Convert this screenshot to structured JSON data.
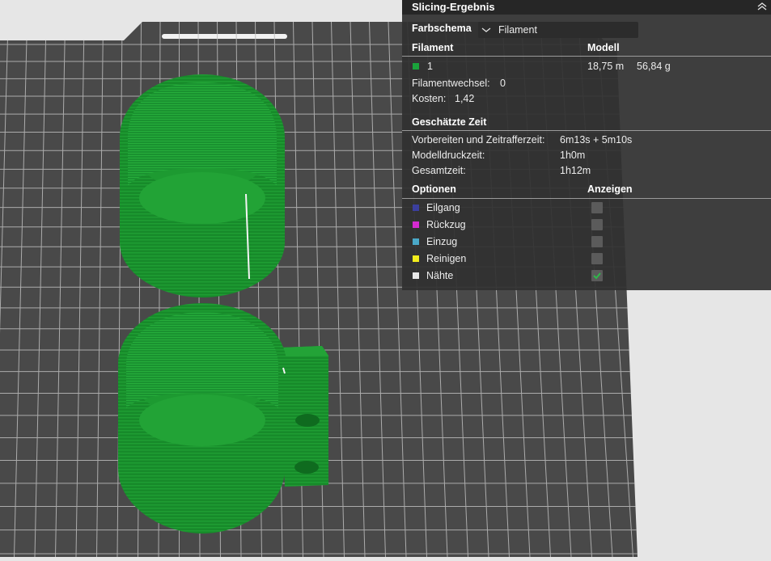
{
  "panel": {
    "title": "Slicing-Ergebnis",
    "color_scheme_label": "Farbschema",
    "color_scheme_value": "Filament",
    "col_filament": "Filament",
    "col_model": "Modell",
    "filament": {
      "id": "1",
      "color": "#1aa33b",
      "length": "18,75 m",
      "weight": "56,84 g"
    },
    "filament_changes_label": "Filamentwechsel:",
    "filament_changes_value": "0",
    "cost_label": "Kosten:",
    "cost_value": "1,42",
    "time_header": "Geschätzte Zeit",
    "prep_label": "Vorbereiten und Zeitrafferzeit:",
    "prep_value": "6m13s + 5m10s",
    "model_time_label": "Modelldruckzeit:",
    "model_time_value": "1h0m",
    "total_label": "Gesamtzeit:",
    "total_value": "1h12m",
    "options_header": "Optionen",
    "show_header": "Anzeigen",
    "options": [
      {
        "label": "Eilgang",
        "color": "#3b3f9e",
        "checked": false
      },
      {
        "label": "Rückzug",
        "color": "#d62ad1",
        "checked": false
      },
      {
        "label": "Einzug",
        "color": "#4aa8c8",
        "checked": false
      },
      {
        "label": "Reinigen",
        "color": "#f2ec1c",
        "checked": false
      },
      {
        "label": "Nähte",
        "color": "#e8e8e8",
        "checked": true
      }
    ],
    "icons": {
      "collapse": "double-chevron-up-icon",
      "dropdown": "chevron-down-icon",
      "check": "checkmark-icon"
    }
  },
  "scene": {
    "plate_color": "#494949",
    "grid_color": "#cfcfcf",
    "model_color": "#178a2a"
  }
}
